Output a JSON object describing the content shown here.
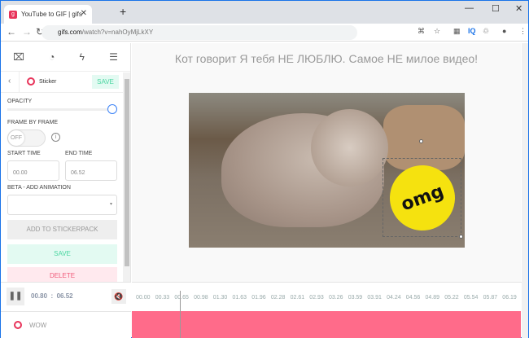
{
  "browser": {
    "tab_title": "YouTube to GIF | gifs",
    "favicon": "g",
    "url_host": "gifs.com",
    "url_path": "/watch?v=nahOyMjLkXY",
    "ext_iq": "IQ"
  },
  "sidebar": {
    "panel_title": "Sticker",
    "save_small": "SAVE",
    "opacity_label": "OPACITY",
    "opacity_value": 1.0,
    "frame_label": "FRAME BY FRAME",
    "frame_toggle": "OFF",
    "start_label": "START TIME",
    "start_value": "00.00",
    "end_label": "END TIME",
    "end_value": "06.52",
    "anim_label": "BETA - ADD ANIMATION",
    "add_pack": "ADD TO STICKERPACK",
    "save": "SAVE",
    "delete": "DELETE"
  },
  "main": {
    "title": "Кот говорит Я тебя НЕ ЛЮБЛЮ. Самое НЕ милое видео!",
    "sticker_text": "omg"
  },
  "player": {
    "time": "00.80  :  06.52",
    "ticks": [
      "00.00",
      "00.33",
      "00.65",
      "00.98",
      "01.30",
      "01.63",
      "01.96",
      "02.28",
      "02.61",
      "02.93",
      "03.26",
      "03.59",
      "03.91",
      "04.24",
      "04.56",
      "04.89",
      "05.22",
      "05.54",
      "05.87",
      "06.19"
    ],
    "layer_label": "WOW"
  }
}
